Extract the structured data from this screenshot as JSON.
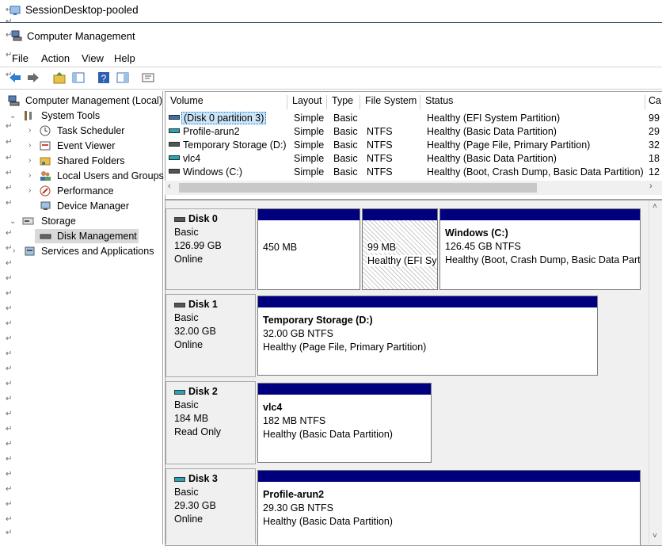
{
  "session": {
    "title": "SessionDesktop-pooled"
  },
  "app": {
    "title": "Computer Management"
  },
  "menu": [
    "File",
    "Action",
    "View",
    "Help"
  ],
  "tree": {
    "root": "Computer Management (Local)",
    "system_tools": "System Tools",
    "task_scheduler": "Task Scheduler",
    "event_viewer": "Event Viewer",
    "shared_folders": "Shared Folders",
    "local_users": "Local Users and Groups",
    "performance": "Performance",
    "device_manager": "Device Manager",
    "storage": "Storage",
    "disk_management": "Disk Management",
    "services": "Services and Applications"
  },
  "list": {
    "columns": [
      "Volume",
      "Layout",
      "Type",
      "File System",
      "Status",
      "Ca"
    ],
    "rows": [
      {
        "volume": "(Disk 0 partition 3)",
        "layout": "Simple",
        "type": "Basic",
        "fs": "",
        "status": "Healthy (EFI System Partition)",
        "cap": "99"
      },
      {
        "volume": "Profile-arun2",
        "layout": "Simple",
        "type": "Basic",
        "fs": "NTFS",
        "status": "Healthy (Basic Data Partition)",
        "cap": "29"
      },
      {
        "volume": "Temporary Storage (D:)",
        "layout": "Simple",
        "type": "Basic",
        "fs": "NTFS",
        "status": "Healthy (Page File, Primary Partition)",
        "cap": "32"
      },
      {
        "volume": "vlc4",
        "layout": "Simple",
        "type": "Basic",
        "fs": "NTFS",
        "status": "Healthy (Basic Data Partition)",
        "cap": "18"
      },
      {
        "volume": "Windows (C:)",
        "layout": "Simple",
        "type": "Basic",
        "fs": "NTFS",
        "status": "Healthy (Boot, Crash Dump, Basic Data Partition)",
        "cap": "12"
      }
    ]
  },
  "disks": {
    "d0": {
      "name": "Disk 0",
      "type": "Basic",
      "size": "126.99 GB",
      "state": "Online",
      "p1": {
        "size": "450 MB"
      },
      "p2": {
        "size": "99 MB",
        "status": "Healthy (EFI Sy"
      },
      "p3": {
        "name": "Windows  (C:)",
        "size": "126.45 GB NTFS",
        "status": "Healthy (Boot, Crash Dump, Basic Data Part"
      }
    },
    "d1": {
      "name": "Disk 1",
      "type": "Basic",
      "size": "32.00 GB",
      "state": "Online",
      "p1": {
        "name": "Temporary Storage  (D:)",
        "size": "32.00 GB NTFS",
        "status": "Healthy (Page File, Primary Partition)"
      }
    },
    "d2": {
      "name": "Disk 2",
      "type": "Basic",
      "size": "184 MB",
      "state": "Read Only",
      "p1": {
        "name": "vlc4",
        "size": "182 MB NTFS",
        "status": "Healthy (Basic Data Partition)"
      }
    },
    "d3": {
      "name": "Disk 3",
      "type": "Basic",
      "size": "29.30 GB",
      "state": "Online",
      "p1": {
        "name": "Profile-arun2",
        "size": "29.30 GB NTFS",
        "status": "Healthy (Basic Data Partition)"
      }
    }
  },
  "colors": {
    "partition_band": "#00007e",
    "selection": "#0078d7",
    "accent": "#2c4a66"
  }
}
